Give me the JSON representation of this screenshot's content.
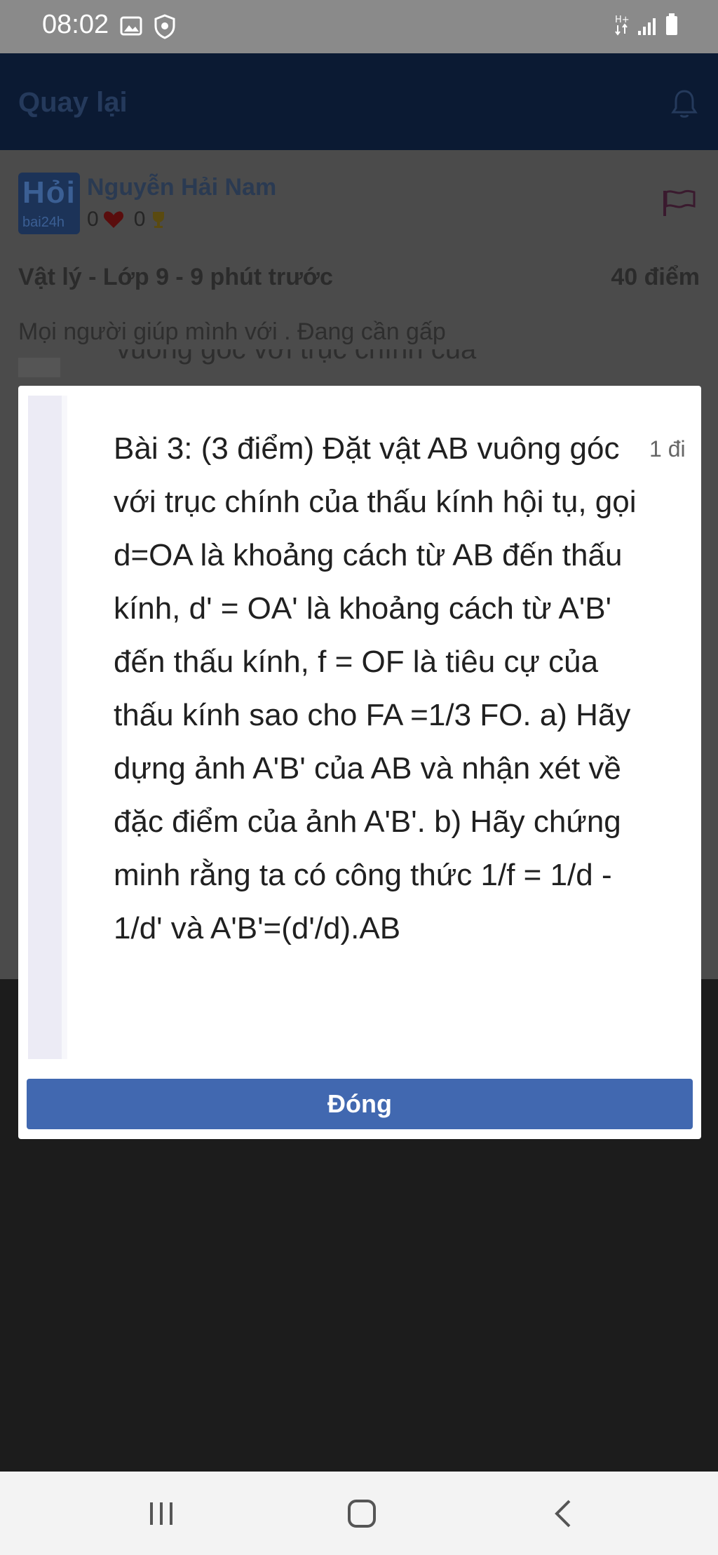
{
  "status_bar": {
    "time": "08:02"
  },
  "app_bar": {
    "back_label": "Quay lại"
  },
  "post": {
    "author": "Nguyễn Hải Nam",
    "hearts": "0",
    "coins": "0",
    "avatar_top": "Hỏi",
    "avatar_bottom": "bai24h",
    "meta": "Vật lý - Lớp 9 - 9 phút trước",
    "points": "40 điểm",
    "intro": "Mọi người giúp mình với .  Đang cần gấp",
    "peek_text": "vuông góc với trục chính của"
  },
  "modal": {
    "text": "Bài 3: (3 điểm) Đặt vật AB vuông góc với trục chính của thấu kính hội tụ, gọi d=OA là khoảng cách từ AB đến thấu kính, d' = OA' là khoảng cách từ A'B' đến thấu kính, f = OF là tiêu cự của thấu kính sao cho FA =1/3 FO. a) Hãy dựng ảnh A'B' của AB và nhận xét về đặc điểm của ảnh A'B'. b) Hãy chứng minh rằng ta có công thức 1/f = 1/d - 1/d' và A'B'=(d'/d).AB",
    "side_label": "1 đi",
    "close_label": "Đóng"
  }
}
